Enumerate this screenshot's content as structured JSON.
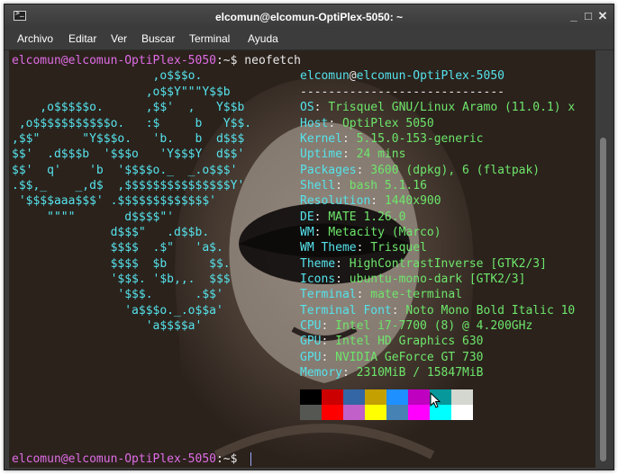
{
  "window": {
    "title": "elcomun@elcomun-OptiPlex-5050: ~",
    "buttons": {
      "minimize": "_",
      "maximize": "□",
      "close": "✕"
    }
  },
  "menubar": {
    "items": [
      "Archivo",
      "Editar",
      "Ver",
      "Buscar",
      "Terminal",
      "Ayuda"
    ]
  },
  "terminal": {
    "prompt_user": "elcomun@elcomun-OptiPlex-5050",
    "prompt_path": ":~$ ",
    "command": "neofetch",
    "logo_lines": [
      "                    ,o$$$o.",
      "                   ,o$$Y\"\"\"Y$$b",
      "    ,o$$$$$o.      ,$$'  ,   Y$$b",
      " ,o$$$$$$$$$$$o.   :$     b   Y$$.",
      ",$$\"      \"Y$$$o.   'b.   b  d$$$",
      "$$'  .d$$$b  '$$$o   'Y$$$Y  d$$'",
      "$$'  q'    'b  '$$$$o._  _.o$$$'",
      ".$$,_    _,d$  ,$$$$$$$$$$$$$$$Y'",
      " '$$$$aaa$$$' .$$$$$$$$$$$$$'",
      "     \"\"\"\"       d$$$$\"'",
      "              d$$$\"   .d$$b.",
      "              $$$$  .$\"   'a$.",
      "              $$$$  $b      $$.",
      "              '$$$. '$b,,.  $$$",
      "               '$$$.      .$$'",
      "                'a$$$o._.o$$a'",
      "                   'a$$$$a'"
    ],
    "user_host": {
      "user": "elcomun",
      "at": "@",
      "host": "elcomun-OptiPlex-5050"
    },
    "separator": "-----------------------------",
    "info": [
      {
        "key": "OS",
        "value": "Trisquel GNU/Linux Aramo (11.0.1) x"
      },
      {
        "key": "Host",
        "value": "OptiPlex 5050"
      },
      {
        "key": "Kernel",
        "value": "5.15.0-153-generic"
      },
      {
        "key": "Uptime",
        "value": "24 mins"
      },
      {
        "key": "Packages",
        "value": "3600 (dpkg), 6 (flatpak)"
      },
      {
        "key": "Shell",
        "value": "bash 5.1.16"
      },
      {
        "key": "Resolution",
        "value": "1440x900"
      },
      {
        "key": "DE",
        "value": "MATE 1.26.0"
      },
      {
        "key": "WM",
        "value": "Metacity (Marco)"
      },
      {
        "key": "WM Theme",
        "value": "Trisquel"
      },
      {
        "key": "Theme",
        "value": "HighContrastInverse [GTK2/3]"
      },
      {
        "key": "Icons",
        "value": "ubuntu-mono-dark [GTK2/3]"
      },
      {
        "key": "Terminal",
        "value": "mate-terminal"
      },
      {
        "key": "Terminal Font",
        "value": "Noto Mono Bold Italic 10"
      },
      {
        "key": "CPU",
        "value": "Intel i7-7700 (8) @ 4.200GHz"
      },
      {
        "key": "GPU",
        "value": "Intel HD Graphics 630"
      },
      {
        "key": "GPU",
        "value": "NVIDIA GeForce GT 730"
      },
      {
        "key": "Memory",
        "value": "2310MiB / 15847MiB"
      }
    ],
    "palette": {
      "row1": [
        "#000000",
        "#cc0000",
        "#3465a4",
        "#c4a000",
        "#1e90ff",
        "#c000c0",
        "#06989a",
        "#d3d7cf"
      ],
      "row2": [
        "#555753",
        "#ff0000",
        "#c060c8",
        "#ffff00",
        "#4682b4",
        "#ff00ff",
        "#00ffff",
        "#ffffff"
      ]
    },
    "final_prompt_user": "elcomun@elcomun-OptiPlex-5050",
    "final_prompt_path": ":~$ "
  },
  "colors": {
    "prompt": "#e06ce6",
    "logo": "#55e3ec",
    "info_key": "#55e3ec",
    "info_value": "#6ee66b",
    "background": "#2b221c"
  }
}
